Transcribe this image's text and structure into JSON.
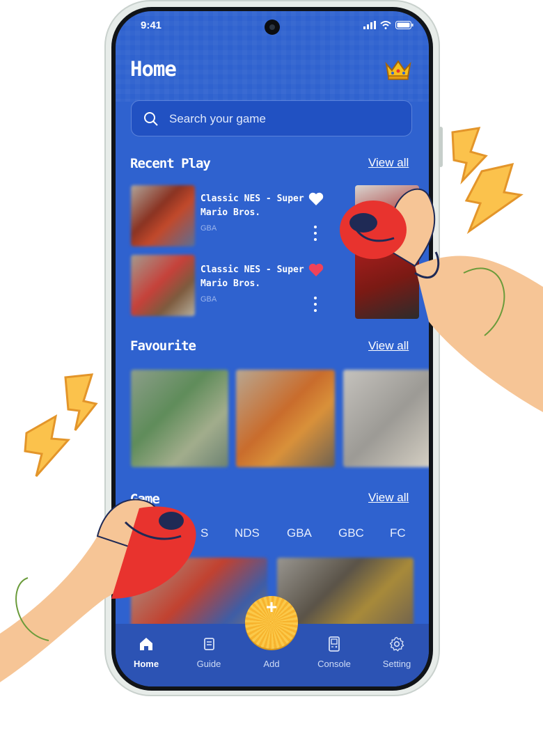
{
  "status": {
    "time": "9:41"
  },
  "header": {
    "title": "Home"
  },
  "search": {
    "placeholder": "Search your game"
  },
  "recent": {
    "title": "Recent Play",
    "view_all": "View all",
    "items": [
      {
        "title": "Classic NES - Super Mario Bros.",
        "platform": "GBA",
        "favourite": false
      },
      {
        "title": "Classic NES - Super Mario Bros.",
        "platform": "GBA",
        "favourite": true
      }
    ]
  },
  "favourite": {
    "title": "Favourite",
    "view_all": "View all"
  },
  "all_game": {
    "title_visible": "Game",
    "view_all": "View all",
    "tabs": [
      "S",
      "NDS",
      "GBA",
      "GBC",
      "FC"
    ]
  },
  "nav": {
    "items": [
      {
        "label": "Home",
        "icon": "home-icon",
        "active": true
      },
      {
        "label": "Guide",
        "icon": "guide-icon",
        "active": false
      },
      {
        "label": "Add",
        "icon": "plus-icon",
        "active": false
      },
      {
        "label": "Console",
        "icon": "console-icon",
        "active": false
      },
      {
        "label": "Setting",
        "icon": "gear-icon",
        "active": false
      }
    ],
    "fab_symbol": "+"
  },
  "colors": {
    "screen_bg": "#2f62cf",
    "nav_bg": "#2c53b4",
    "accent_yellow": "#f7b42e",
    "heart_red": "#f0425a",
    "skin": "#f6c596",
    "controller_red": "#e8332e"
  }
}
